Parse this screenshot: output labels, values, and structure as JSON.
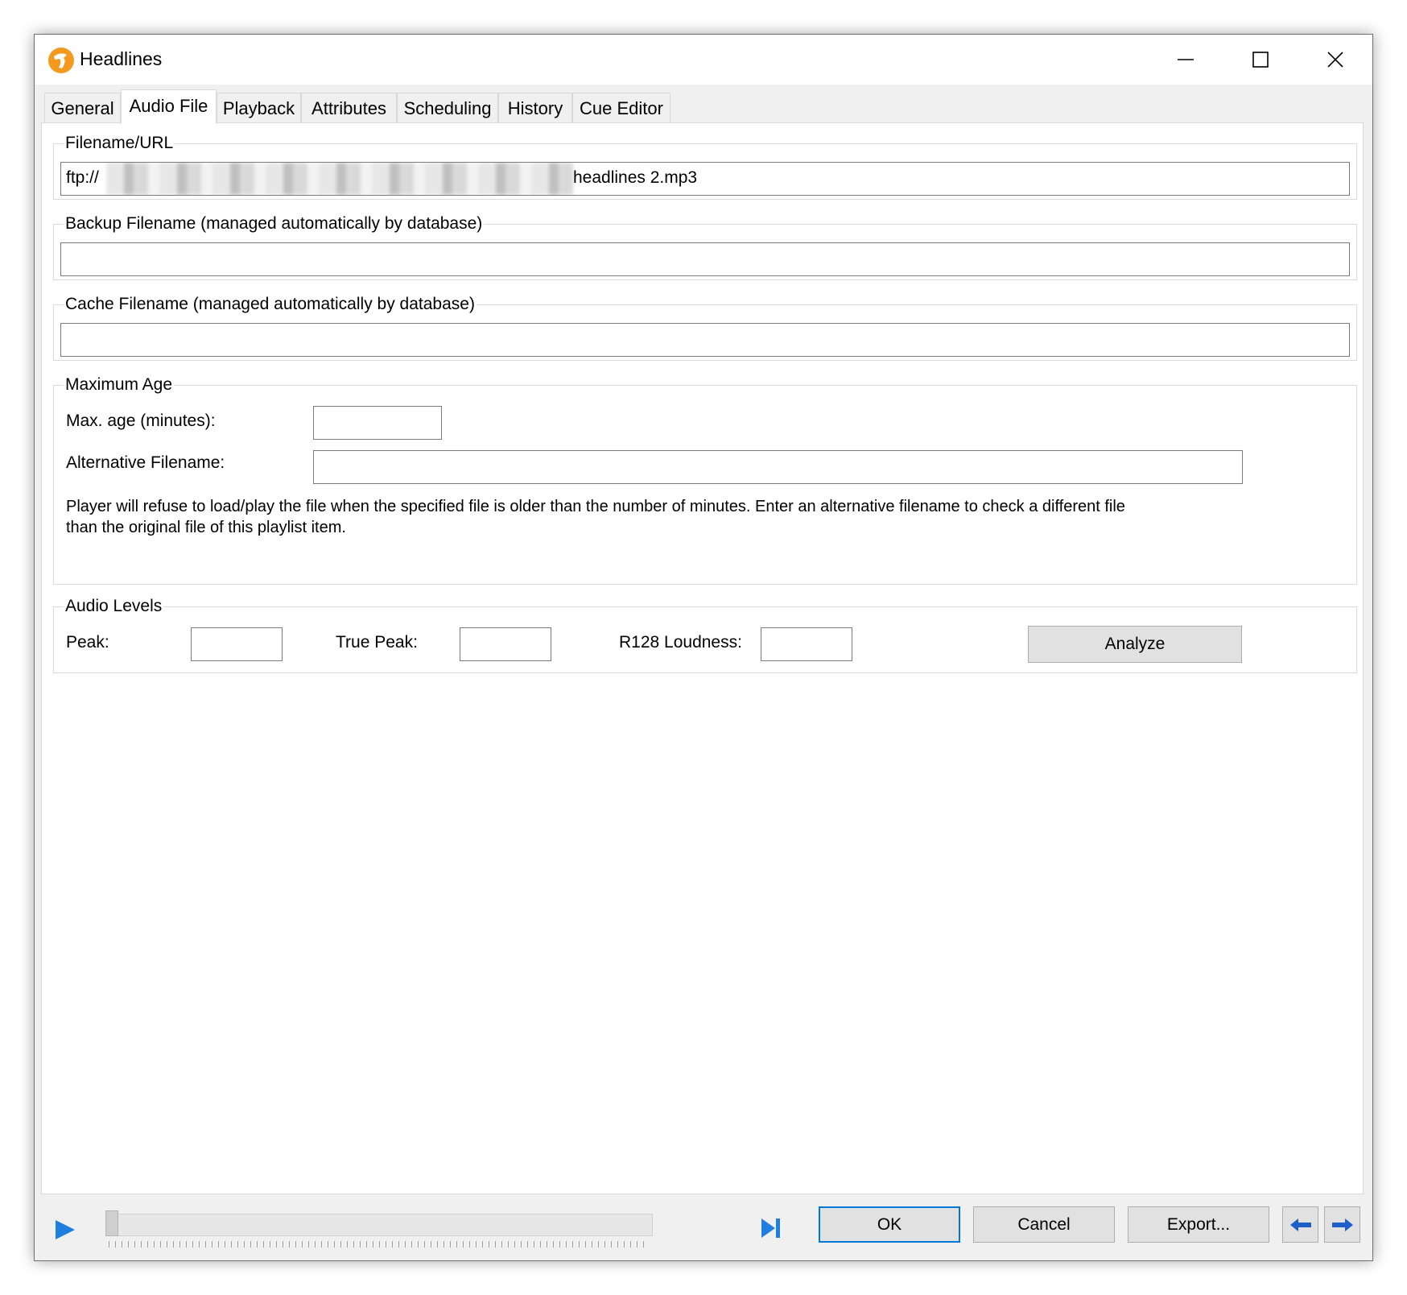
{
  "window": {
    "title": "Headlines"
  },
  "tabs": [
    {
      "label": "General"
    },
    {
      "label": "Audio File"
    },
    {
      "label": "Playback"
    },
    {
      "label": "Attributes"
    },
    {
      "label": "Scheduling"
    },
    {
      "label": "History"
    },
    {
      "label": "Cue Editor"
    }
  ],
  "active_tab": "Audio File",
  "filename_group": {
    "legend": "Filename/URL",
    "value_prefix": "ftp://",
    "value_suffix": "headlines 2.mp3"
  },
  "backup_group": {
    "legend": "Backup Filename (managed automatically by database)",
    "value": ""
  },
  "cache_group": {
    "legend": "Cache Filename (managed automatically by database)",
    "value": ""
  },
  "max_age_group": {
    "legend": "Maximum Age",
    "max_age_label": "Max. age (minutes):",
    "max_age_value": "",
    "alt_filename_label": "Alternative Filename:",
    "alt_filename_value": "",
    "description": "Player will refuse to load/play the file when the specified file is older than the number of minutes. Enter an alternative filename to check a different file than the original file of this playlist item."
  },
  "audio_levels_group": {
    "legend": "Audio Levels",
    "peak_label": "Peak:",
    "peak_value": "",
    "true_peak_label": "True Peak:",
    "true_peak_value": "",
    "loudness_label": "R128 Loudness:",
    "loudness_value": "",
    "analyze_label": "Analyze"
  },
  "footer": {
    "ok_label": "OK",
    "cancel_label": "Cancel",
    "export_label": "Export...",
    "seek_position": 0
  },
  "icons": {
    "app": "app-logo-icon",
    "play": "play-icon",
    "next": "skip-next-icon",
    "prev_item": "arrow-left-icon",
    "next_item": "arrow-right-icon"
  },
  "colors": {
    "accent": "#0078d7",
    "icon_blue": "#1e7fe0",
    "app_orange": "#f39a1e"
  }
}
